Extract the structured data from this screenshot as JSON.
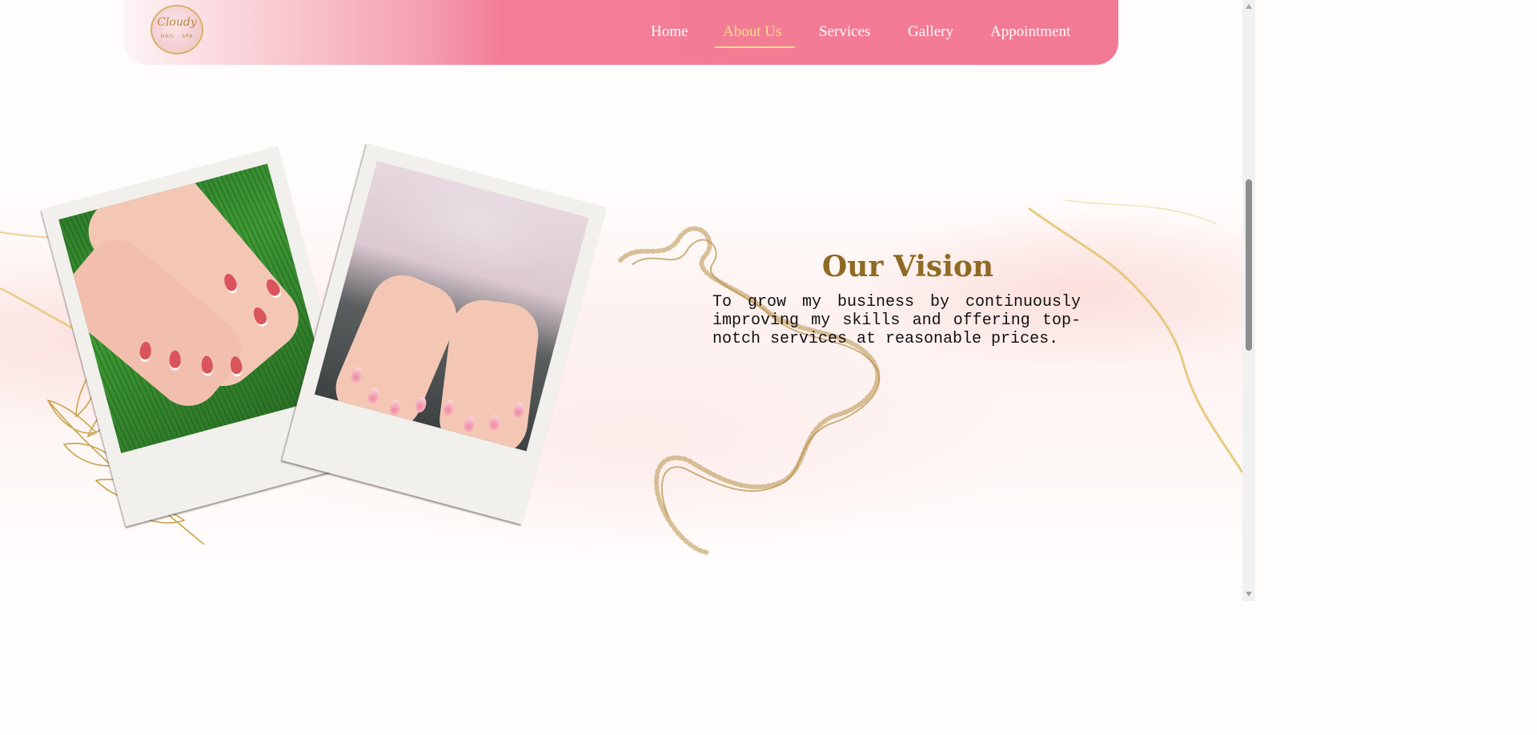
{
  "header": {
    "logo_text": "Cloudy",
    "logo_subtext": "NAIL · SPA",
    "nav": [
      {
        "label": "Home"
      },
      {
        "label": "About Us"
      },
      {
        "label": "Services"
      },
      {
        "label": "Gallery"
      },
      {
        "label": "Appointment"
      }
    ],
    "active_item": "About Us"
  },
  "vision": {
    "title": "Our Vision",
    "body": "To grow my business by continuously improving my skills and offering top-notch services at reasonable prices."
  },
  "gallery": {
    "photos": [
      {
        "name": "Red almond nails with white bow tips on grass"
      },
      {
        "name": "Pink ombre nails with fuzzy pink sweater"
      }
    ]
  },
  "colors": {
    "header_pink": "#f37a94",
    "active_nav": "#f9df86",
    "title_gold": "#8f6a24",
    "gold_accent": "#c9a24a"
  }
}
